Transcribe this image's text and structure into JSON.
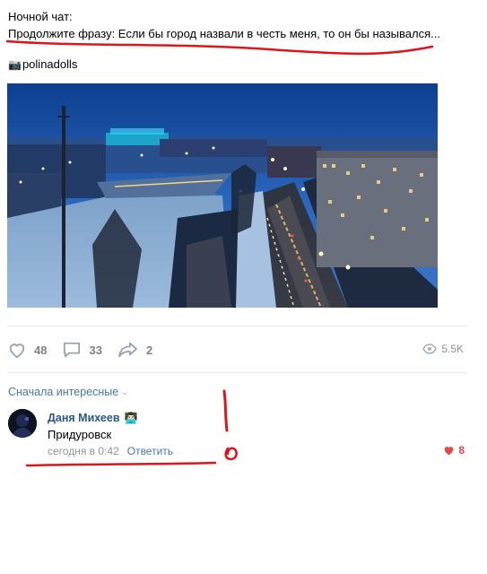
{
  "post": {
    "line1": "Ночной чат:",
    "line2": "Продолжите фразу: Если бы город назвали в честь меня, то он бы назывался...",
    "camera_icon": "📷",
    "author": "polinadolls"
  },
  "actions": {
    "likes": "48",
    "comments": "33",
    "shares": "2",
    "views": "5.5K"
  },
  "comments_sort": "Сначала интересные",
  "comment": {
    "author": "Даня Михеев",
    "author_emoji": "👨🏻‍💻",
    "text": "Придуровск",
    "time": "сегодня в 0:42",
    "reply": "Ответить",
    "likes": "8"
  },
  "colors": {
    "link": "#2a5885",
    "accent": "#4a76a8",
    "like_red": "#e64646",
    "annotation_red": "#e0141b"
  }
}
